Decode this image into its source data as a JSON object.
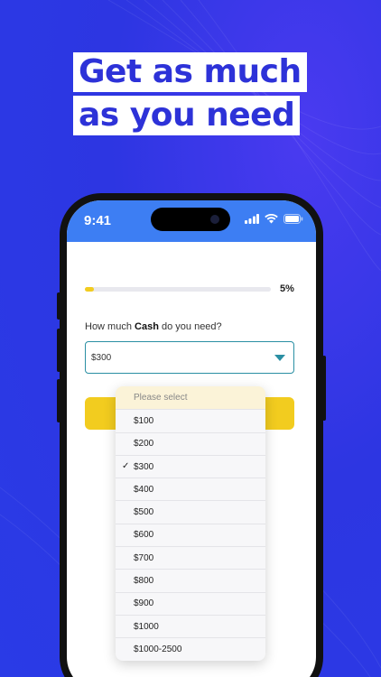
{
  "headline": {
    "line1": "Get as much",
    "line2": "as you need"
  },
  "status": {
    "time": "9:41"
  },
  "progress": {
    "label": "5%",
    "value_percent": 5
  },
  "form": {
    "question_prefix": "How much ",
    "question_bold": "Cash",
    "question_suffix": " do you need?",
    "selected_value": "$300"
  },
  "dropdown": {
    "placeholder": "Please select",
    "options": [
      "$100",
      "$200",
      "$300",
      "$400",
      "$500",
      "$600",
      "$700",
      "$800",
      "$900",
      "$1000",
      "$1000-2500"
    ],
    "checked": "$300",
    "check_glyph": "✓"
  },
  "colors": {
    "background": "#2f35e0",
    "headline_text": "#2d32d8",
    "status_bar": "#3d7ef3",
    "accent_yellow": "#f2cc1f",
    "select_border": "#2a8fa3"
  }
}
